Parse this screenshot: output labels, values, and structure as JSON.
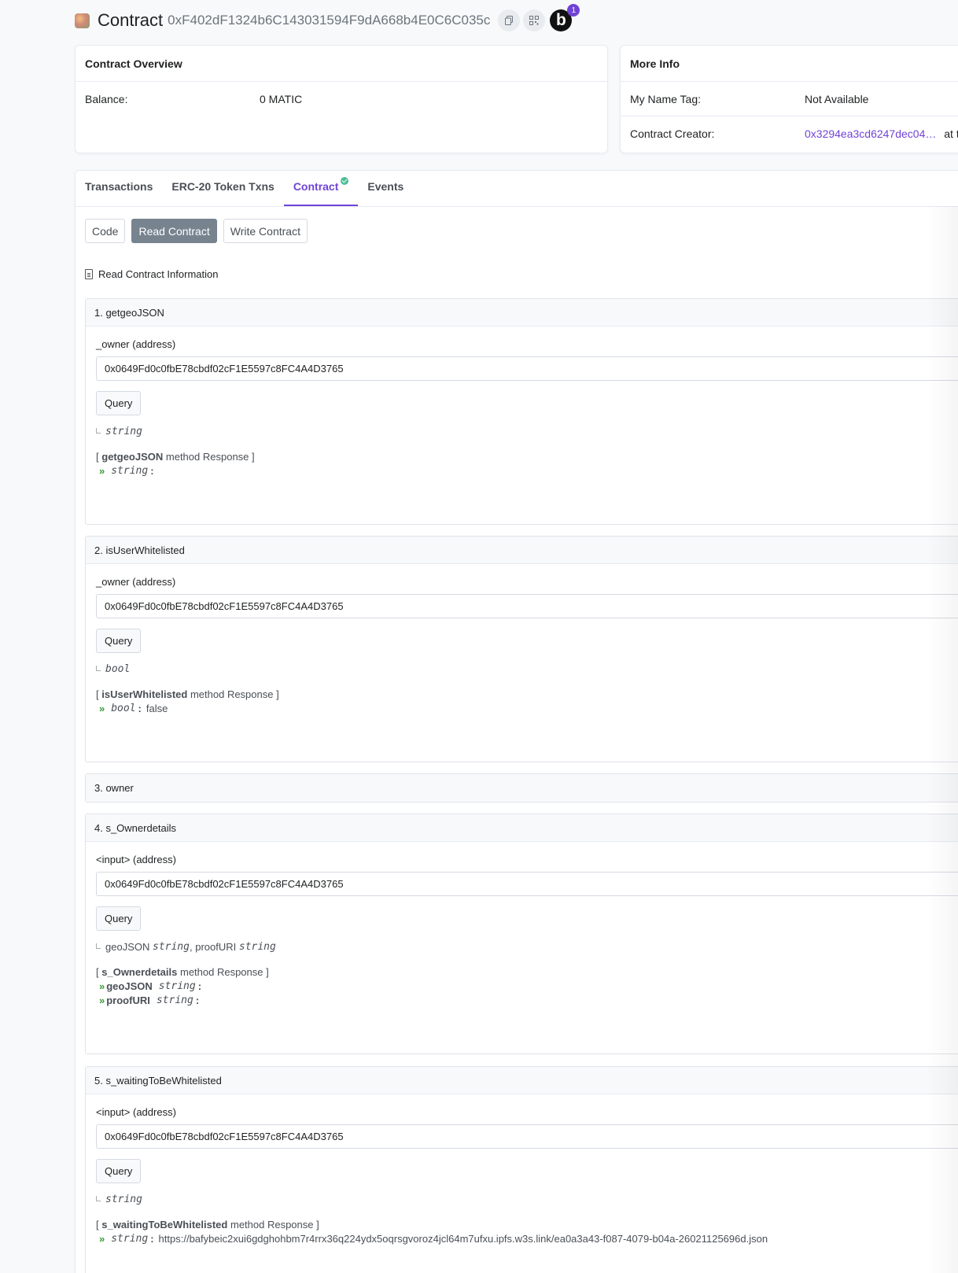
{
  "header": {
    "title": "Contract",
    "address": "0xF402dF1324b6C143031594F9dA668b4E0C6C035c",
    "notification_count": "1",
    "b_label": "b"
  },
  "overview": {
    "title": "Contract Overview",
    "balance_label": "Balance:",
    "balance_value": "0 MATIC"
  },
  "more_info": {
    "title": "More Info",
    "name_tag_label": "My Name Tag:",
    "name_tag_value": "Not Available",
    "creator_label": "Contract Creator:",
    "creator_value": "0x3294ea3cd6247dec04…",
    "creator_suffix": "at t"
  },
  "tabs": [
    {
      "label": "Transactions"
    },
    {
      "label": "ERC-20 Token Txns"
    },
    {
      "label": "Contract"
    },
    {
      "label": "Events"
    }
  ],
  "subtabs": [
    {
      "label": "Code"
    },
    {
      "label": "Read Contract"
    },
    {
      "label": "Write Contract"
    }
  ],
  "read_info_title": "Read Contract Information",
  "functions": [
    {
      "title": "1. getgeoJSON",
      "param_label": "_owner (address)",
      "input_value": "0x0649Fd0c0fbE78cbdf02cF1E5597c8FC4A4D3765",
      "query_label": "Query",
      "return_type": "string",
      "response_name": "getgeoJSON",
      "response_suffix": "method Response ]",
      "response_prefix": "[",
      "resp_type": "string",
      "resp_value": ""
    },
    {
      "title": "2. isUserWhitelisted",
      "param_label": "_owner (address)",
      "input_value": "0x0649Fd0c0fbE78cbdf02cF1E5597c8FC4A4D3765",
      "query_label": "Query",
      "return_type": "bool",
      "response_name": "isUserWhitelisted",
      "response_suffix": "method Response ]",
      "response_prefix": "[",
      "resp_type": "bool",
      "resp_value": "false"
    },
    {
      "title": "3. owner"
    },
    {
      "title": "4. s_Ownerdetails",
      "param_label": "<input> (address)",
      "input_value": "0x0649Fd0c0fbE78cbdf02cF1E5597c8FC4A4D3765",
      "query_label": "Query",
      "return_name_1": "geoJSON",
      "return_type_1": "string",
      "return_sep": ",",
      "return_name_2": "proofURI",
      "return_type_2": "string",
      "response_name": "s_Ownerdetails",
      "response_suffix": "method Response ]",
      "response_prefix": "[",
      "resp_rows": [
        {
          "name": "geoJSON",
          "type": "string",
          "value": ""
        },
        {
          "name": "proofURI",
          "type": "string",
          "value": ""
        }
      ]
    },
    {
      "title": "5. s_waitingToBeWhitelisted",
      "param_label": "<input> (address)",
      "input_value": "0x0649Fd0c0fbE78cbdf02cF1E5597c8FC4A4D3765",
      "query_label": "Query",
      "return_type": "string",
      "response_name": "s_waitingToBeWhitelisted",
      "response_suffix": "method Response ]",
      "response_prefix": "[",
      "resp_type": "string",
      "resp_value": "https://bafybeic2xui6gdghohbm7r4rrx36q224ydx5oqrsgvoroz4jcl64m7ufxu.ipfs.w3s.link/ea0a3a43-f087-4079-b04a-26021125696d.json"
    }
  ],
  "colors": {
    "accent": "#7043d6",
    "verified": "#4bbf96",
    "arrow": "#3a9a3a",
    "active_subtab": "#77838f"
  }
}
